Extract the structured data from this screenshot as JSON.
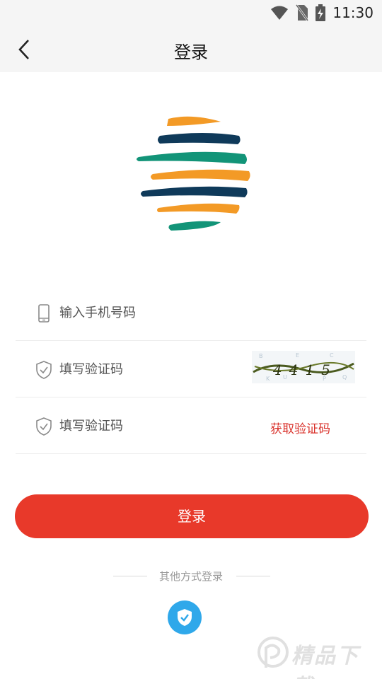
{
  "status_bar": {
    "time": "11:30",
    "icons": [
      "wifi-icon",
      "no-sim-icon",
      "battery-charging-icon"
    ]
  },
  "header": {
    "title": "登录",
    "back_icon": "chevron-left-icon"
  },
  "form": {
    "phone": {
      "placeholder": "输入手机号码",
      "icon": "phone-icon"
    },
    "captcha_input": {
      "placeholder": "填写验证码",
      "icon": "shield-icon",
      "captcha_text": "4415"
    },
    "sms_code": {
      "placeholder": "填写验证码",
      "icon": "shield-icon",
      "get_code_label": "获取验证码"
    }
  },
  "login_button": {
    "label": "登录"
  },
  "other_login": {
    "label": "其他方式登录",
    "option_icon": "shield-check-icon"
  },
  "watermark": {
    "text": "精品下载"
  },
  "colors": {
    "accent_red": "#e8392a",
    "link_red": "#d9302a",
    "alt_blue": "#2fa8ea",
    "logo_orange": "#f39a26",
    "logo_navy": "#0f3a5a",
    "logo_green": "#129478"
  }
}
